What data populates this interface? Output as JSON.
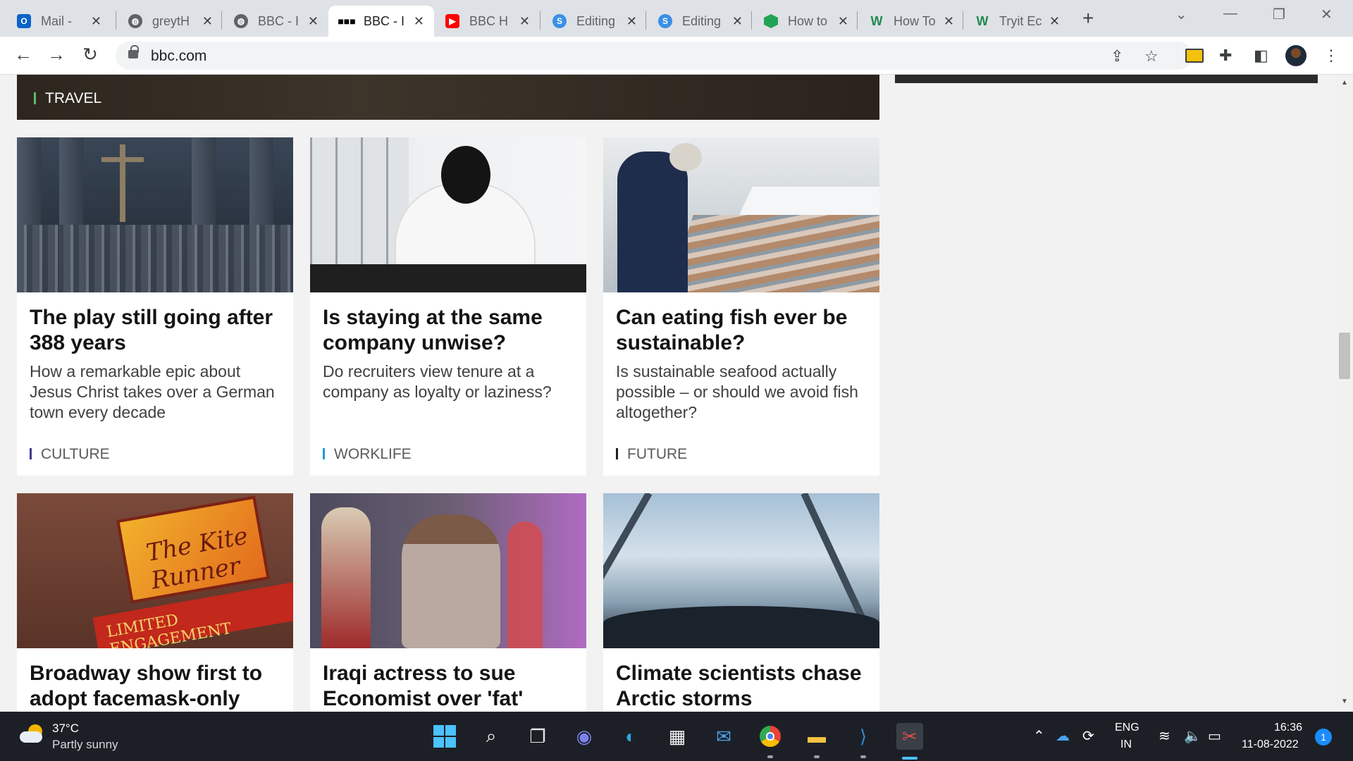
{
  "browser": {
    "tabs": [
      {
        "title": "Mail - ",
        "favicon": "outlook-icon",
        "color": "#0a64c8"
      },
      {
        "title": "greytH",
        "favicon": "globe-icon",
        "color": "#5f6368"
      },
      {
        "title": "BBC - I",
        "favicon": "globe-icon",
        "color": "#5f6368"
      },
      {
        "title": "BBC - I",
        "favicon": "bbc-icon",
        "color": "#000000"
      },
      {
        "title": "BBC H",
        "favicon": "youtube-icon",
        "color": "#ff0000"
      },
      {
        "title": "Editing",
        "favicon": "editing-icon",
        "color": "#3b8fe6"
      },
      {
        "title": "Editing",
        "favicon": "editing-icon",
        "color": "#3b8fe6"
      },
      {
        "title": "How to",
        "favicon": "hexagon-icon",
        "color": "#23a455"
      },
      {
        "title": "How To",
        "favicon": "w-icon",
        "color": "#1f8a4c"
      },
      {
        "title": "Tryit Ec",
        "favicon": "w-icon",
        "color": "#1f8a4c"
      }
    ],
    "url": "bbc.com"
  },
  "page": {
    "hero_label": "TRAVEL",
    "cards": [
      {
        "title": "The play still going after 388 years",
        "summary": "How a remarkable epic about Jesus Christ takes over a German town every decade",
        "tag": "CULTURE",
        "tag_color": "#3d3a8c"
      },
      {
        "title": "Is staying at the same company unwise?",
        "summary": "Do recruiters view tenure at a company as loyalty or laziness?",
        "tag": "WORKLIFE",
        "tag_color": "#1f9bd6"
      },
      {
        "title": "Can eating fish ever be sustainable?",
        "summary": "Is sustainable seafood actually possible – or should we avoid fish altogether?",
        "tag": "FUTURE",
        "tag_color": "#1f1f1f"
      },
      {
        "title": "Broadway show first to adopt facemask-only"
      },
      {
        "title": "Iraqi actress to sue Economist over 'fat'"
      },
      {
        "title": "Climate scientists chase Arctic storms"
      }
    ],
    "image_signs": {
      "kite": "The Kite Runner",
      "limited": "LIMITED ENGAGEMENT"
    }
  },
  "taskbar": {
    "temperature": "37°C",
    "condition": "Partly sunny",
    "language": "ENG",
    "region": "IN",
    "time": "16:36",
    "date": "11-08-2022",
    "notifications": "1"
  }
}
